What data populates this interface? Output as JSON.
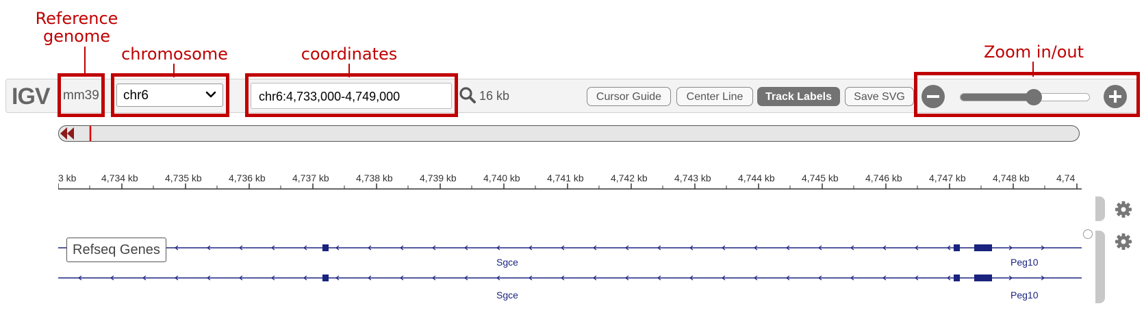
{
  "annotations": {
    "reference_genome": "Reference genome",
    "chromosome": "chromosome",
    "coordinates": "coordinates",
    "zoom": "Zoom in/out"
  },
  "navbar": {
    "logo": "IGV",
    "genome": "mm39",
    "chromosome": "chr6",
    "locus": "chr6:4,733,000-4,749,000",
    "window_size": "16 kb",
    "buttons": {
      "cursor_guide": "Cursor Guide",
      "center_line": "Center Line",
      "track_labels": "Track Labels",
      "save_svg": "Save SVG"
    },
    "zoom_level": 0.57
  },
  "ruler": {
    "ticks": [
      "3 kb",
      "4,734 kb",
      "4,735 kb",
      "4,736 kb",
      "4,737 kb",
      "4,738 kb",
      "4,739 kb",
      "4,740 kb",
      "4,741 kb",
      "4,742 kb",
      "4,743 kb",
      "4,744 kb",
      "4,745 kb",
      "4,746 kb",
      "4,747 kb",
      "4,748 kb",
      "4,74"
    ]
  },
  "tracks": {
    "label": "Refseq Genes",
    "genes": [
      {
        "name": "Sgce"
      },
      {
        "name": "Peg10"
      },
      {
        "name": "Sgce"
      },
      {
        "name": "Peg10"
      }
    ]
  },
  "colors": {
    "annotation": "#c00000",
    "gene": "#1a237e"
  }
}
